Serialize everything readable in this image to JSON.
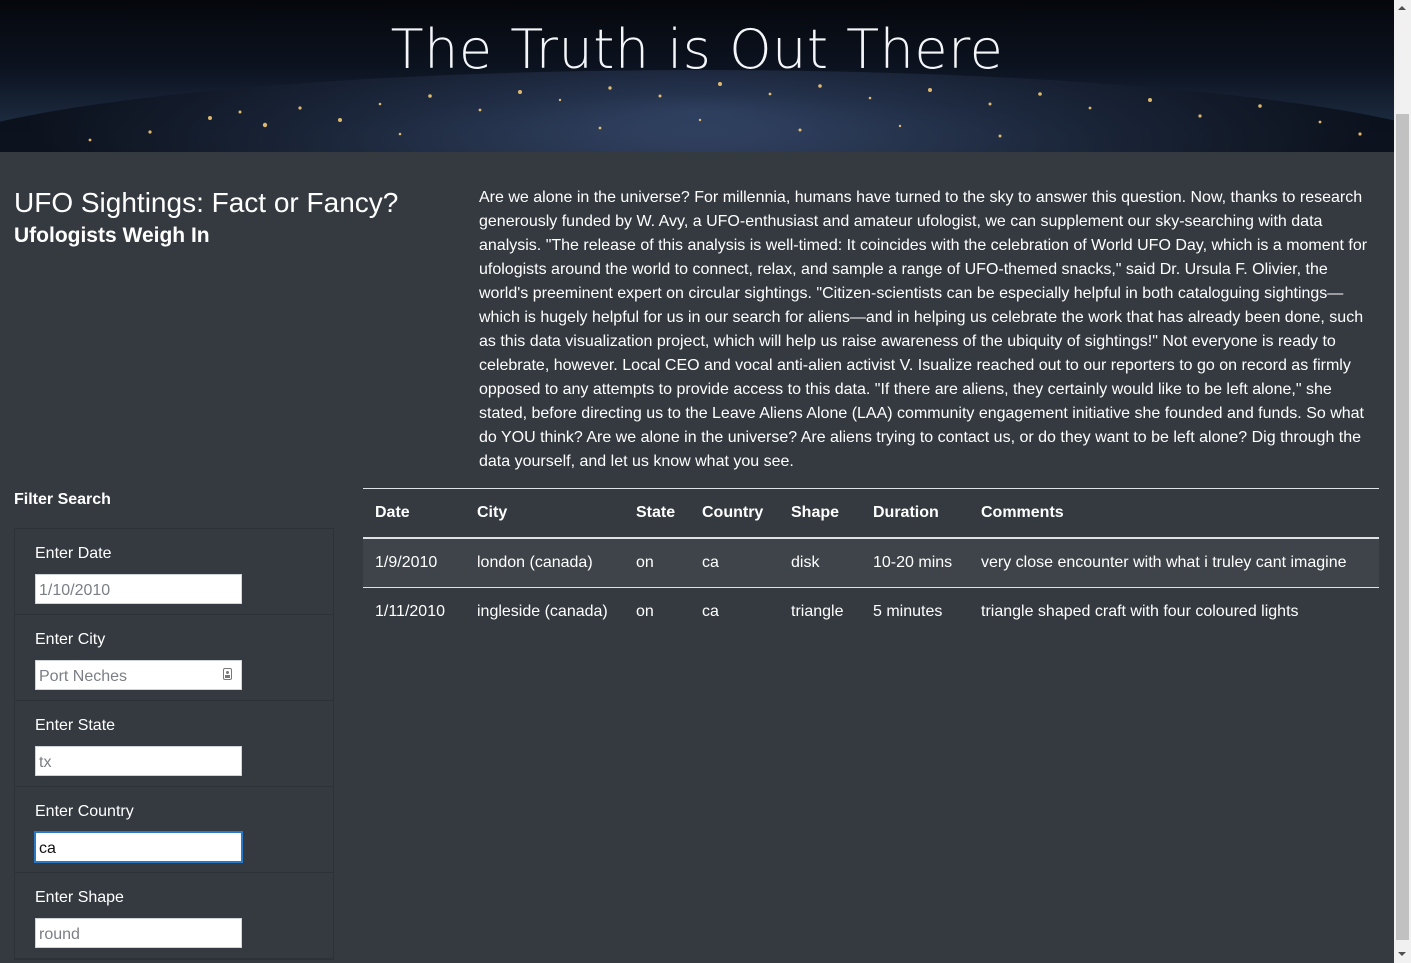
{
  "hero": {
    "title": "The Truth is Out There"
  },
  "header": {
    "title": "UFO Sightings: Fact or Fancy?",
    "subtitle": "Ufologists Weigh In"
  },
  "article": {
    "text": "Are we alone in the universe? For millennia, humans have turned to the sky to answer this question. Now, thanks to research generously funded by W. Avy, a UFO-enthusiast and amateur ufologist, we can supplement our sky-searching with data analysis. \"The release of this analysis is well-timed: It coincides with the celebration of World UFO Day, which is a moment for ufologists around the world to connect, relax, and sample a range of UFO-themed snacks,\" said Dr. Ursula F. Olivier, the world's preeminent expert on circular sightings. \"Citizen-scientists can be especially helpful in both cataloguing sightings—which is hugely helpful for us in our search for aliens—and in helping us celebrate the work that has already been done, such as this data visualization project, which will help us raise awareness of the ubiquity of sightings!\" Not everyone is ready to celebrate, however. Local CEO and vocal anti-alien activist V. Isualize reached out to our reporters to go on record as firmly opposed to any attempts to provide access to this data. \"If there are aliens, they certainly would like to be left alone,\" she stated, before directing us to the Leave Aliens Alone (LAA) community engagement initiative she founded and funds. So what do YOU think? Are we alone in the universe? Are aliens trying to contact us, or do they want to be left alone? Dig through the data yourself, and let us know what you see."
  },
  "filters": {
    "heading": "Filter Search",
    "items": [
      {
        "label": "Enter Date",
        "placeholder": "1/10/2010",
        "value": ""
      },
      {
        "label": "Enter City",
        "placeholder": "Port Neches",
        "value": ""
      },
      {
        "label": "Enter State",
        "placeholder": "tx",
        "value": ""
      },
      {
        "label": "Enter Country",
        "placeholder": "",
        "value": "ca"
      },
      {
        "label": "Enter Shape",
        "placeholder": "round",
        "value": ""
      }
    ]
  },
  "table": {
    "headers": [
      "Date",
      "City",
      "State",
      "Country",
      "Shape",
      "Duration",
      "Comments"
    ],
    "rows": [
      [
        "1/9/2010",
        "london (canada)",
        "on",
        "ca",
        "disk",
        "10-20 mins",
        "very close encounter with what i truley cant imagine"
      ],
      [
        "1/11/2010",
        "ingleside (canada)",
        "on",
        "ca",
        "triangle",
        "5 minutes",
        "triangle shaped craft with four coloured lights"
      ]
    ]
  },
  "colors": {
    "background": "#343a40",
    "text": "#ffffff",
    "focus_outline": "#2b78c5"
  },
  "icons": {
    "city_field": "contact-card-icon"
  }
}
